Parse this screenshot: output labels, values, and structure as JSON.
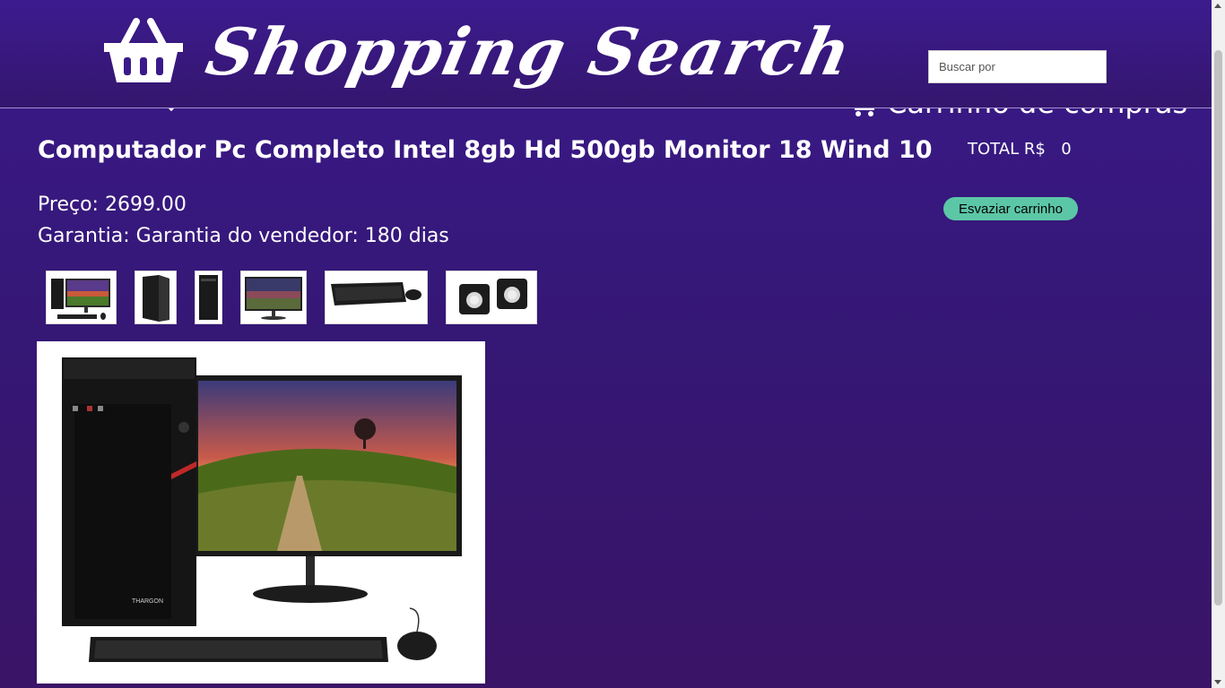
{
  "header": {
    "logo_text": "Shopping Search",
    "logo_icon": "basket-icon",
    "search_placeholder": "Buscar por"
  },
  "product": {
    "title": "Computador Pc Completo Intel 8gb Hd 500gb Monitor 18 Wind 10",
    "price_label": "Preço:",
    "price_value": "2699.00",
    "warranty_label": "Garantia:",
    "warranty_value": "Garantia do vendedor: 180 dias",
    "thumbnails": [
      {
        "name": "thumb-full-set"
      },
      {
        "name": "thumb-tower-angle"
      },
      {
        "name": "thumb-tower-front"
      },
      {
        "name": "thumb-monitor"
      },
      {
        "name": "thumb-keyboard-mouse"
      },
      {
        "name": "thumb-speakers"
      }
    ]
  },
  "cart": {
    "heading": "Carrinho de compras",
    "icon": "cart-icon",
    "total_label": "TOTAL R$",
    "total_value": "0",
    "empty_button": "Esvaziar carrinho"
  },
  "colors": {
    "background": "#36177a",
    "button": "#5cc7a6"
  }
}
